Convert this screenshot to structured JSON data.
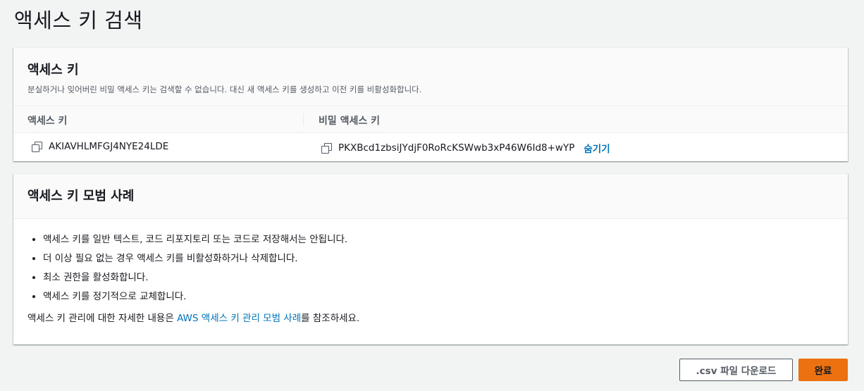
{
  "page": {
    "title": "액세스 키 검색"
  },
  "keys_panel": {
    "title": "액세스 키",
    "description": "분실하거나 잊어버린 비밀 액세스 키는 검색할 수 없습니다. 대신 새 액세스 키를 생성하고 이전 키를 비활성화합니다.",
    "columns": [
      "액세스 키",
      "비밀 액세스 키"
    ],
    "access_key_id": "AKIAVHLMFGJ4NYE24LDE",
    "secret_access_key": "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",
    "hide_label": "숨기기",
    "copy_icon": "copy-icon"
  },
  "best_practices": {
    "title": "액세스 키 모범 사례",
    "items": [
      "액세스 키를 일반 텍스트, 코드 리포지토리 또는 코드로 저장해서는 안됩니다.",
      "더 이상 필요 없는 경우 액세스 키를 비활성화하거나 삭제합니다.",
      "최소 권한을 활성화합니다.",
      "액세스 키를 정기적으로 교체합니다."
    ],
    "reference_prefix": "액세스 키 관리에 대한 자세한 내용은 ",
    "reference_link": "AWS 액세스 키 관리 모범 사례",
    "reference_suffix": "를 참조하세요."
  },
  "actions": {
    "download_label": ".csv 파일 다운로드",
    "done_label": "완료"
  },
  "colors": {
    "background": "#f2f3f3",
    "link": "#0073bb",
    "primary_button": "#ec7211"
  }
}
